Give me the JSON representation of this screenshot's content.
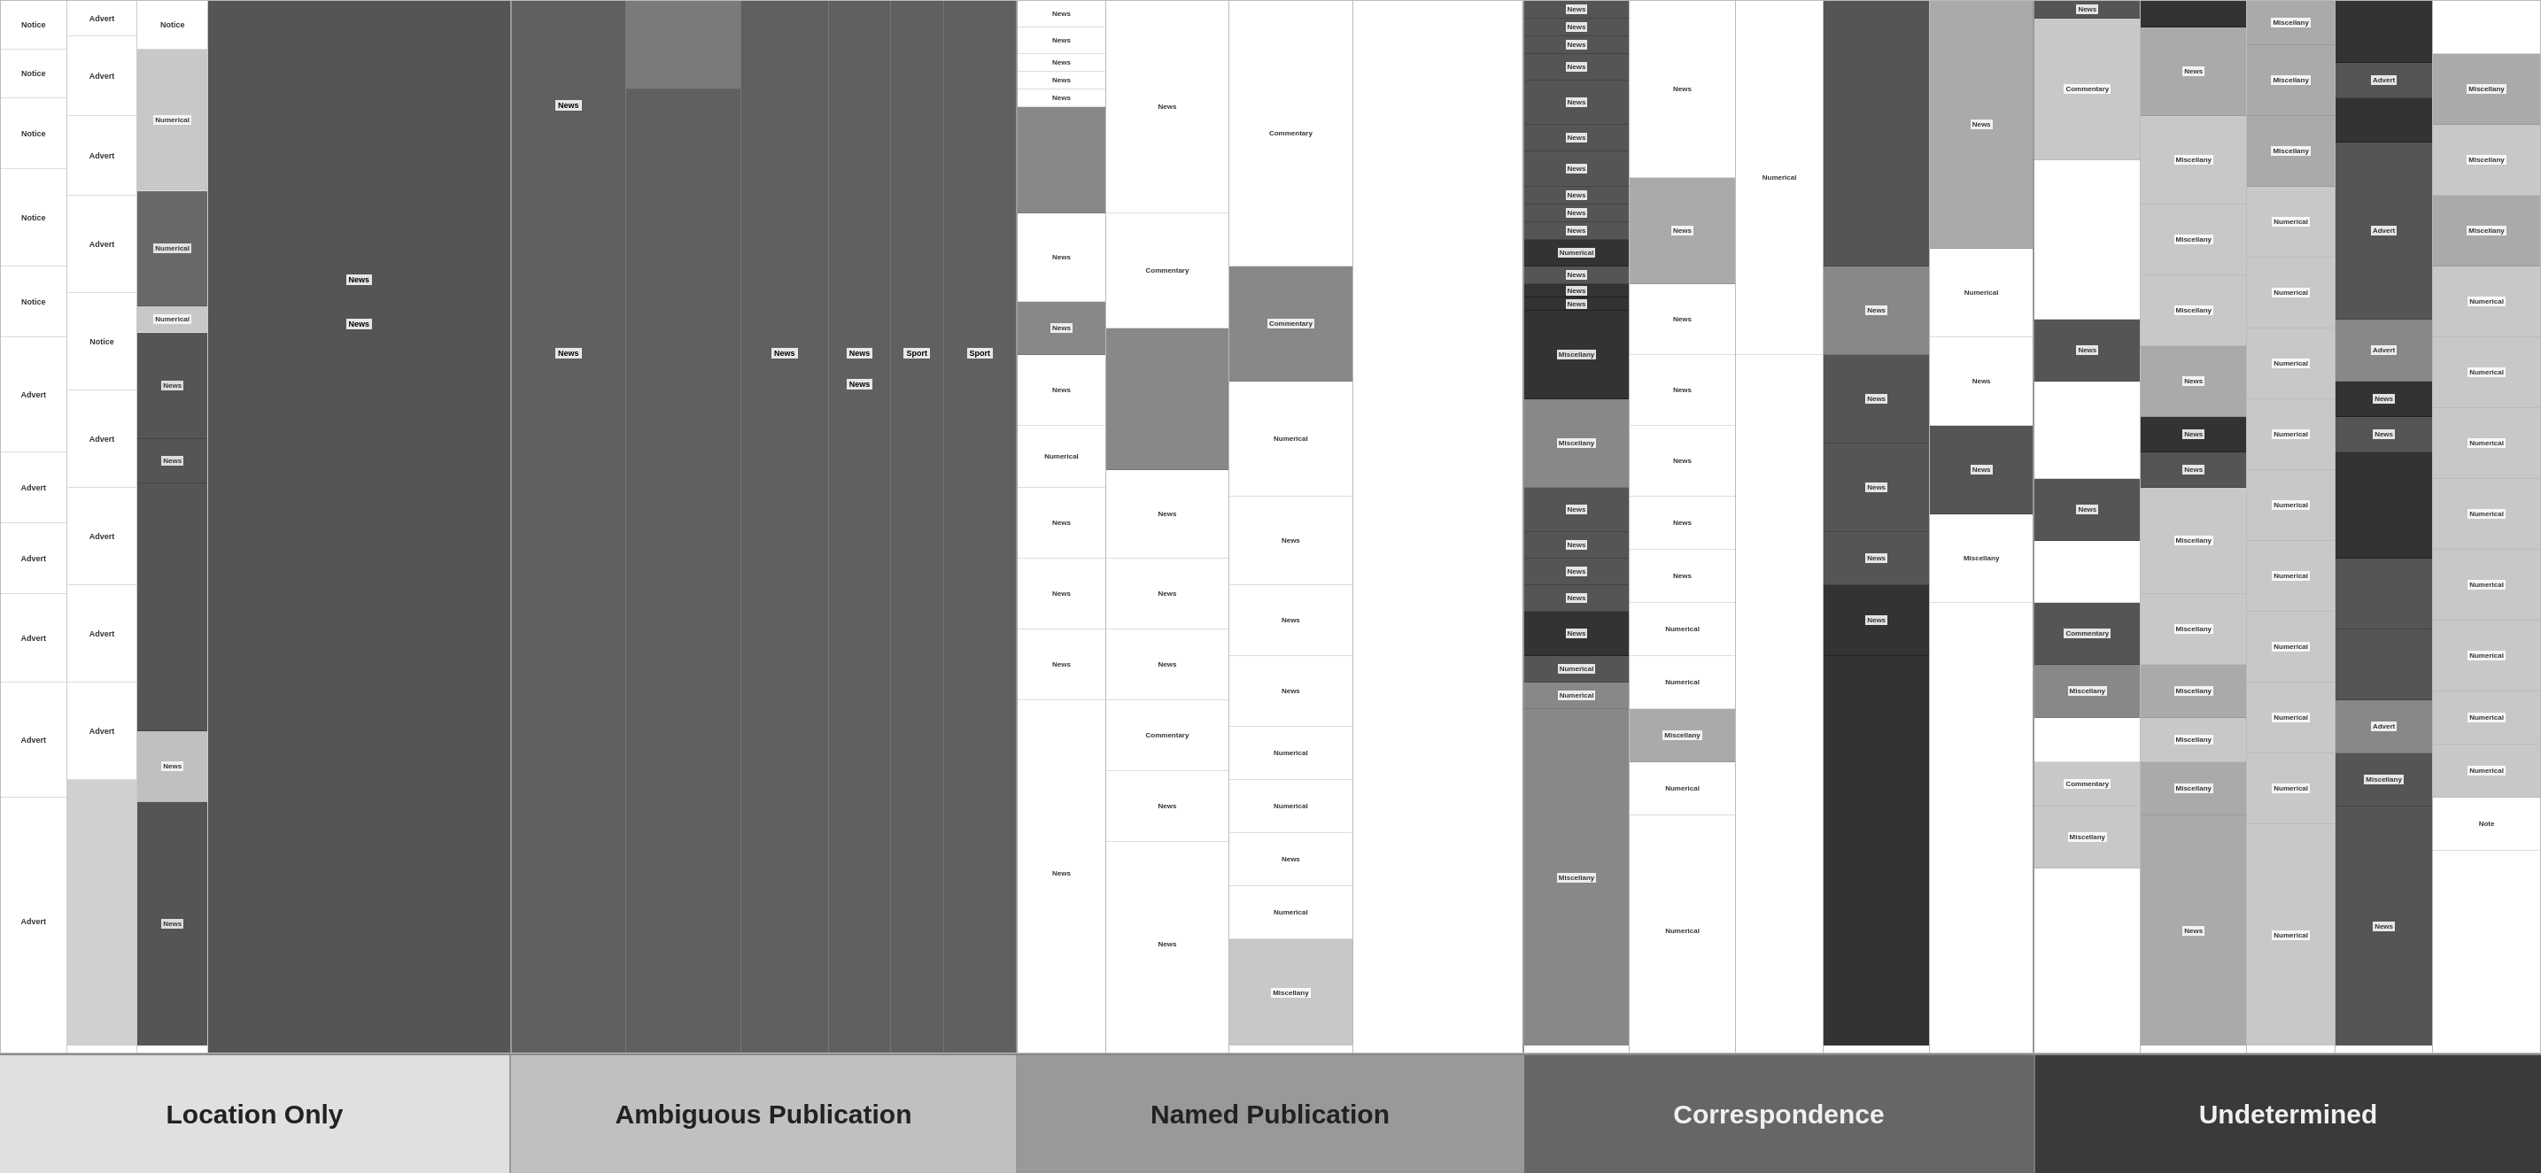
{
  "legend": [
    {
      "id": "location-only",
      "label": "Location Only",
      "color": "#e0e0e0",
      "width_pct": 20
    },
    {
      "id": "ambiguous-publication",
      "label": "Ambiguous Publication",
      "color": "#c0c0c0",
      "width_pct": 20
    },
    {
      "id": "named-publication",
      "label": "Named Publication",
      "color": "#999999",
      "width_pct": 20
    },
    {
      "id": "correspondence",
      "label": "Correspondence",
      "color": "#666666",
      "width_pct": 20
    },
    {
      "id": "undetermined",
      "label": "Undetermined",
      "color": "#3a3a3a",
      "width_pct": 20
    }
  ],
  "colors": {
    "white": "#ffffff",
    "light_gray": "#d8d8d8",
    "mid_gray": "#aaaaaa",
    "dark_gray": "#666666",
    "darker_gray": "#444444",
    "darkest_gray": "#2a2a2a"
  }
}
